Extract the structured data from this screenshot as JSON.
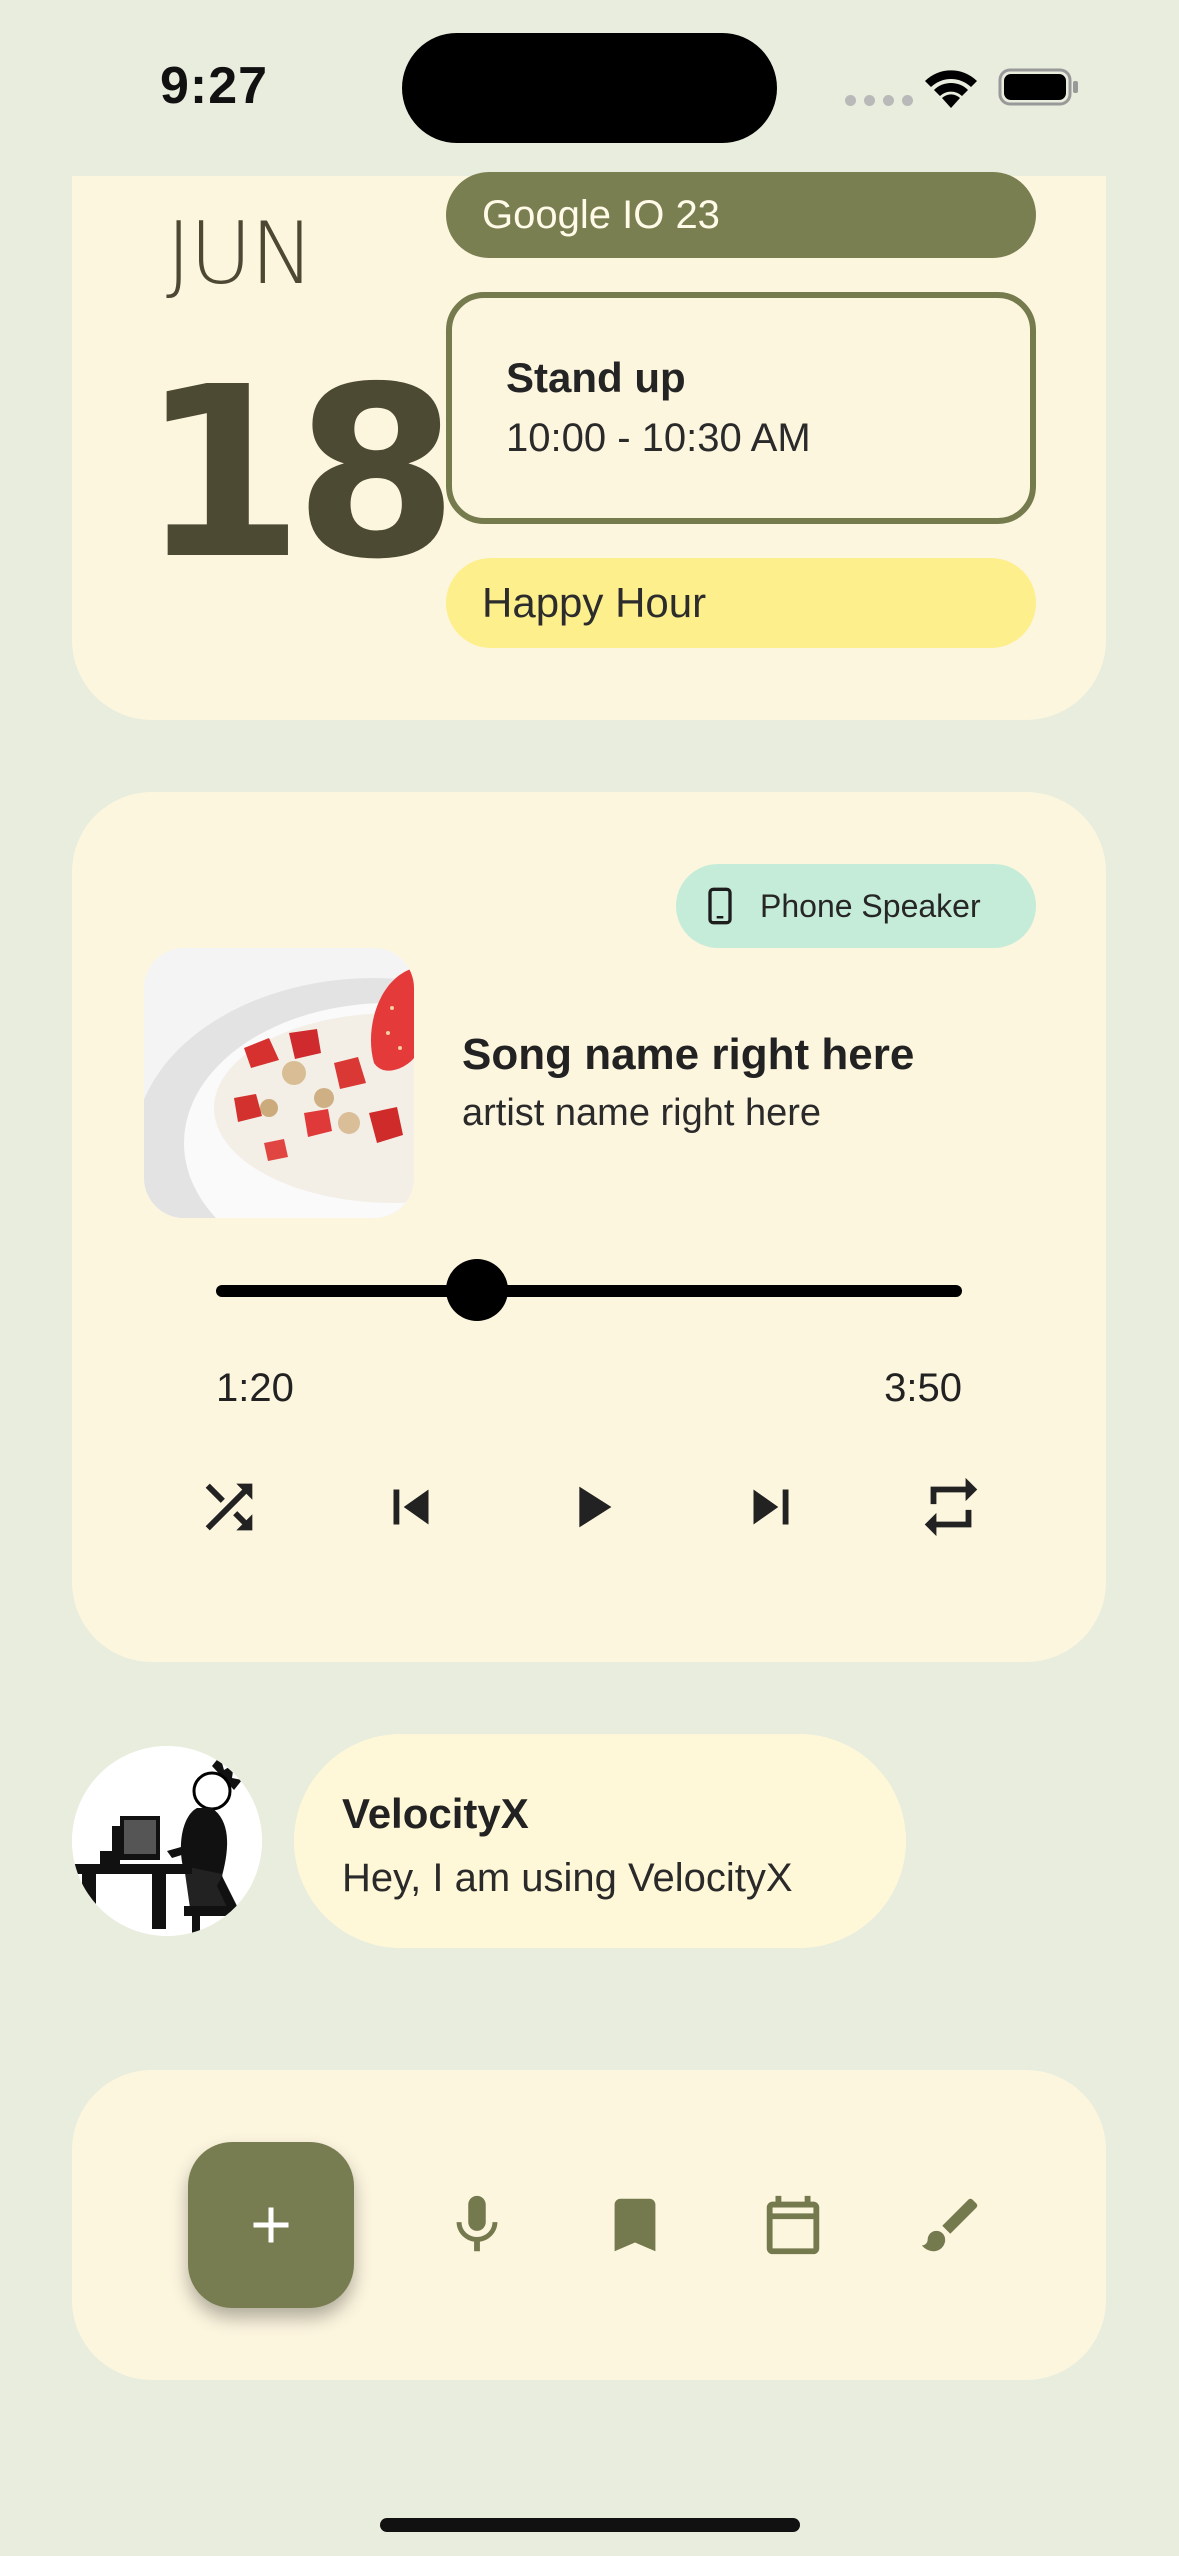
{
  "status_bar": {
    "time": "9:27"
  },
  "calendar": {
    "month": "JUN",
    "day": "18",
    "events": [
      {
        "title": "Google IO 23"
      },
      {
        "title": "Stand up",
        "time": "10:00 - 10:30 AM"
      },
      {
        "title": "Happy Hour"
      }
    ]
  },
  "music": {
    "output_device": "Phone Speaker",
    "song": "Song name right here",
    "artist": "artist name right here",
    "current_time": "1:20",
    "total_time": "3:50",
    "progress": 0.35,
    "controls": [
      "shuffle-icon",
      "skip-previous-icon",
      "play-icon",
      "skip-next-icon",
      "repeat-icon"
    ]
  },
  "profile": {
    "name": "VelocityX",
    "status": "Hey, I am using VelocityX"
  },
  "bottom_bar": {
    "icons": [
      "add-icon",
      "mic-icon",
      "bookmark-icon",
      "calendar-icon",
      "brush-icon"
    ]
  },
  "colors": {
    "background": "#e8eddd",
    "card": "#fdf6df",
    "accent": "#787d51",
    "happy_hour": "#fdef8b",
    "speaker_chip": "#c5ecd8"
  }
}
